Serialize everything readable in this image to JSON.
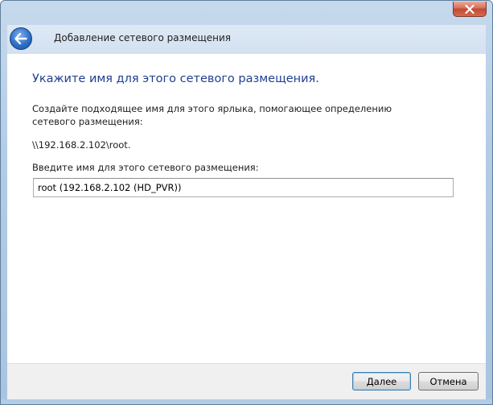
{
  "window": {
    "header_title": "Добавление сетевого размещения",
    "close_label": "×"
  },
  "content": {
    "main_title": "Укажите имя для этого сетевого размещения.",
    "description": "Создайте подходящее имя для этого ярлыка, помогающее определению сетевого размещения:",
    "network_path": "\\\\192.168.2.102\\root.",
    "input_label": "Введите имя для этого сетевого размещения:",
    "input_value": "root (192.168.2.102 (HD_PVR))"
  },
  "footer": {
    "next_label": "Далее",
    "cancel_label": "Отмена"
  },
  "icons": {
    "back": "back-arrow-icon",
    "close": "close-icon"
  },
  "colors": {
    "title_blue": "#1f3f8f",
    "close_red": "#c24a33",
    "back_blue": "#2f6fc9"
  }
}
